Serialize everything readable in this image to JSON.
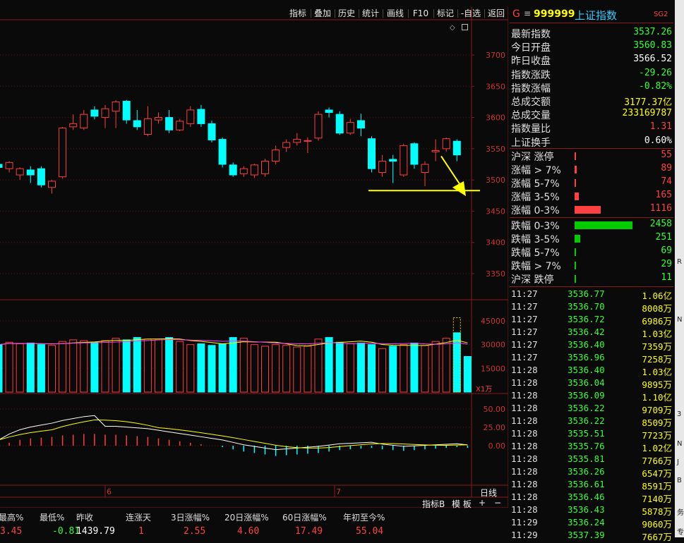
{
  "toolbar": {
    "items": [
      "指标",
      "叠加",
      "历史",
      "统计",
      "画线",
      "F10",
      "标记",
      "-自选",
      "返回"
    ]
  },
  "chart": {
    "price_axis": [
      "3700",
      "3650",
      "3600",
      "3550",
      "3500",
      "3450",
      "3400",
      "3350"
    ],
    "volume_axis": [
      "45000",
      "30000",
      "15000"
    ],
    "volume_unit": "X1万",
    "macd_axis": [
      "50.00",
      "25.00",
      "0.00"
    ],
    "date_labels": [
      "6",
      "7"
    ],
    "period_button": "日线",
    "indicator_tabs": [
      "指标B",
      "模 板",
      "+",
      "−"
    ],
    "colors": {
      "up": "#ff3c3c",
      "down": "#00ffff",
      "ma_white": "#ffffff",
      "ma_yellow": "#ffff00",
      "ma_magenta": "#ff40ff",
      "arrow": "#ffff00"
    },
    "candles": [
      {
        "o": 3525,
        "c": 3520,
        "h": 3528,
        "l": 3515
      },
      {
        "o": 3518,
        "c": 3528,
        "h": 3530,
        "l": 3512
      },
      {
        "o": 3508,
        "c": 3518,
        "h": 3520,
        "l": 3500
      },
      {
        "o": 3516,
        "c": 3508,
        "h": 3522,
        "l": 3495
      },
      {
        "o": 3518,
        "c": 3492,
        "h": 3522,
        "l": 3488
      },
      {
        "o": 3488,
        "c": 3498,
        "h": 3500,
        "l": 3478
      },
      {
        "o": 3505,
        "c": 3583,
        "h": 3585,
        "l": 3502
      },
      {
        "o": 3585,
        "c": 3590,
        "h": 3605,
        "l": 3580
      },
      {
        "o": 3583,
        "c": 3605,
        "h": 3612,
        "l": 3580
      },
      {
        "o": 3612,
        "c": 3602,
        "h": 3618,
        "l": 3597
      },
      {
        "o": 3600,
        "c": 3614,
        "h": 3620,
        "l": 3583
      },
      {
        "o": 3610,
        "c": 3625,
        "h": 3628,
        "l": 3583
      },
      {
        "o": 3626,
        "c": 3596,
        "h": 3628,
        "l": 3590
      },
      {
        "o": 3595,
        "c": 3585,
        "h": 3612,
        "l": 3580
      },
      {
        "o": 3573,
        "c": 3598,
        "h": 3618,
        "l": 3570
      },
      {
        "o": 3596,
        "c": 3600,
        "h": 3608,
        "l": 3590
      },
      {
        "o": 3600,
        "c": 3580,
        "h": 3612,
        "l": 3575
      },
      {
        "o": 3580,
        "c": 3594,
        "h": 3598,
        "l": 3578
      },
      {
        "o": 3590,
        "c": 3612,
        "h": 3618,
        "l": 3585
      },
      {
        "o": 3613,
        "c": 3590,
        "h": 3620,
        "l": 3585
      },
      {
        "o": 3590,
        "c": 3564,
        "h": 3595,
        "l": 3560
      },
      {
        "o": 3565,
        "c": 3525,
        "h": 3568,
        "l": 3520
      },
      {
        "o": 3524,
        "c": 3508,
        "h": 3528,
        "l": 3505
      },
      {
        "o": 3510,
        "c": 3518,
        "h": 3522,
        "l": 3505
      },
      {
        "o": 3508,
        "c": 3524,
        "h": 3526,
        "l": 3503
      },
      {
        "o": 3510,
        "c": 3530,
        "h": 3534,
        "l": 3505
      },
      {
        "o": 3530,
        "c": 3548,
        "h": 3555,
        "l": 3525
      },
      {
        "o": 3552,
        "c": 3560,
        "h": 3565,
        "l": 3545
      },
      {
        "o": 3560,
        "c": 3565,
        "h": 3575,
        "l": 3555
      },
      {
        "o": 3562,
        "c": 3563,
        "h": 3568,
        "l": 3543
      },
      {
        "o": 3567,
        "c": 3605,
        "h": 3610,
        "l": 3563
      },
      {
        "o": 3612,
        "c": 3608,
        "h": 3616,
        "l": 3600
      },
      {
        "o": 3605,
        "c": 3575,
        "h": 3610,
        "l": 3572
      },
      {
        "o": 3575,
        "c": 3592,
        "h": 3598,
        "l": 3572
      },
      {
        "o": 3595,
        "c": 3583,
        "h": 3606,
        "l": 3570
      },
      {
        "o": 3566,
        "c": 3518,
        "h": 3570,
        "l": 3512
      },
      {
        "o": 3512,
        "c": 3530,
        "h": 3540,
        "l": 3505
      },
      {
        "o": 3533,
        "c": 3530,
        "h": 3540,
        "l": 3495
      },
      {
        "o": 3508,
        "c": 3555,
        "h": 3558,
        "l": 3505
      },
      {
        "o": 3558,
        "c": 3525,
        "h": 3560,
        "l": 3518
      },
      {
        "o": 3512,
        "c": 3525,
        "h": 3530,
        "l": 3490
      },
      {
        "o": 3545,
        "c": 3547,
        "h": 3565,
        "l": 3530
      },
      {
        "o": 3550,
        "c": 3566,
        "h": 3568,
        "l": 3545
      },
      {
        "o": 3562,
        "c": 3540,
        "h": 3565,
        "l": 3530
      }
    ],
    "volumes": [
      30000,
      31500,
      30500,
      31000,
      30000,
      29500,
      32000,
      33000,
      32500,
      31500,
      32500,
      34000,
      33000,
      34500,
      33500,
      33000,
      34500,
      32000,
      30000,
      30500,
      29500,
      30500,
      34500,
      34000,
      30000,
      29000,
      30000,
      29500,
      28500,
      29000,
      33500,
      34500,
      31500,
      30500,
      31000,
      30000,
      27500,
      29000,
      30000,
      31000,
      29500,
      32000,
      34000,
      37500,
      22500
    ],
    "macd_bars": [
      -2,
      4,
      8,
      10,
      11,
      12,
      14,
      15,
      16,
      16,
      15,
      15,
      14,
      13,
      12,
      10,
      8,
      6,
      4,
      2,
      0,
      -2,
      -5,
      -8,
      -10,
      -12,
      -14,
      -13,
      -12,
      -11,
      -10,
      -8,
      -6,
      -5,
      -4,
      -3,
      -5,
      -6,
      -7,
      -6,
      -5,
      -4,
      -3,
      -2,
      -3
    ]
  },
  "quote": {
    "prefix": "G",
    "code": "999999",
    "name": "上证指数",
    "badge": "SG2",
    "rows": [
      {
        "label": "最新指数",
        "value": "3537.26",
        "color": "#33ff33"
      },
      {
        "label": "今日开盘",
        "value": "3560.83",
        "color": "#33ff33"
      },
      {
        "label": "昨日收盘",
        "value": "3566.52",
        "color": "#ffffff"
      },
      {
        "label": "指数涨跌",
        "value": "-29.26",
        "color": "#33ff33"
      },
      {
        "label": "指数涨幅",
        "value": "-0.82%",
        "color": "#33ff33"
      },
      {
        "label": "总成交额",
        "value": "3177.37亿",
        "color": "#ffff00"
      },
      {
        "label": "总成交量",
        "value": "233169787",
        "color": "#ffff00"
      },
      {
        "label": "指数量比",
        "value": "1.31",
        "color": "#ff4040"
      },
      {
        "label": "上证换手",
        "value": "0.60%",
        "color": "#ffffff"
      }
    ]
  },
  "breadth": [
    {
      "label": "沪深 涨停",
      "value": "55",
      "ratio": 0.0,
      "dir": "up"
    },
    {
      "label": "涨幅 > 7%",
      "value": "89",
      "ratio": 0.036,
      "dir": "up"
    },
    {
      "label": "涨幅 5-7%",
      "value": "74",
      "ratio": 0.03,
      "dir": "up"
    },
    {
      "label": "涨幅 3-5%",
      "value": "165",
      "ratio": 0.07,
      "dir": "up"
    },
    {
      "label": "涨幅 0-3%",
      "value": "1116",
      "ratio": 0.45,
      "dir": "up"
    },
    {
      "label": "跌幅 0-3%",
      "value": "2458",
      "ratio": 1.0,
      "dir": "down"
    },
    {
      "label": "跌幅 3-5%",
      "value": "251",
      "ratio": 0.1,
      "dir": "down"
    },
    {
      "label": "跌幅 5-7%",
      "value": "69",
      "ratio": 0.028,
      "dir": "down"
    },
    {
      "label": "跌幅 > 7%",
      "value": "29",
      "ratio": 0.0,
      "dir": "down"
    },
    {
      "label": "沪深 跌停",
      "value": "11",
      "ratio": 0.0,
      "dir": "down"
    }
  ],
  "ticks": [
    {
      "time": "11:27",
      "price": "3536.77",
      "vol": "1.06亿"
    },
    {
      "time": "11:27",
      "price": "3536.70",
      "vol": "8008万"
    },
    {
      "time": "11:27",
      "price": "3536.72",
      "vol": "6986万"
    },
    {
      "time": "11:27",
      "price": "3536.42",
      "vol": "1.03亿"
    },
    {
      "time": "11:27",
      "price": "3536.40",
      "vol": "7359万"
    },
    {
      "time": "11:27",
      "price": "3536.96",
      "vol": "7258万"
    },
    {
      "time": "11:28",
      "price": "3536.40",
      "vol": "1.03亿"
    },
    {
      "time": "11:28",
      "price": "3536.04",
      "vol": "9895万"
    },
    {
      "time": "11:28",
      "price": "3536.09",
      "vol": "1.10亿"
    },
    {
      "time": "11:28",
      "price": "3536.22",
      "vol": "9709万"
    },
    {
      "time": "11:28",
      "price": "3536.22",
      "vol": "8509万"
    },
    {
      "time": "11:28",
      "price": "3535.51",
      "vol": "7723万"
    },
    {
      "time": "11:28",
      "price": "3535.76",
      "vol": "1.02亿"
    },
    {
      "time": "11:28",
      "price": "3535.81",
      "vol": "7766万"
    },
    {
      "time": "11:28",
      "price": "3536.26",
      "vol": "6547万"
    },
    {
      "time": "11:28",
      "price": "3536.61",
      "vol": "8591万"
    },
    {
      "time": "11:28",
      "price": "3536.46",
      "vol": "7140万"
    },
    {
      "time": "11:28",
      "price": "3536.43",
      "vol": "5878万"
    },
    {
      "time": "11:29",
      "price": "3536.24",
      "vol": "9060万"
    },
    {
      "time": "11:29",
      "price": "3537.39",
      "vol": "7667万"
    }
  ],
  "bottom_stats": [
    {
      "head": "最高%",
      "value": "3.45",
      "color": "#ff4040"
    },
    {
      "head": "最低%",
      "value": "-0.81",
      "color": "#33ff33"
    },
    {
      "head": "昨收",
      "value": "1439.79",
      "color": "#ffffff"
    },
    {
      "head": "连涨天",
      "value": "1",
      "color": "#ff4040"
    },
    {
      "head": "3日涨幅%",
      "value": "2.55",
      "color": "#ff4040"
    },
    {
      "head": "20日涨幅%",
      "value": "4.60",
      "color": "#ff4040"
    },
    {
      "head": "60日涨幅%",
      "value": "17.49",
      "color": "#ff4040"
    },
    {
      "head": "年初至今%",
      "value": "55.04",
      "color": "#ff4040"
    }
  ],
  "edge_labels": [
    "R",
    "N",
    "3",
    "N",
    "J",
    "B",
    "务",
    "专"
  ]
}
